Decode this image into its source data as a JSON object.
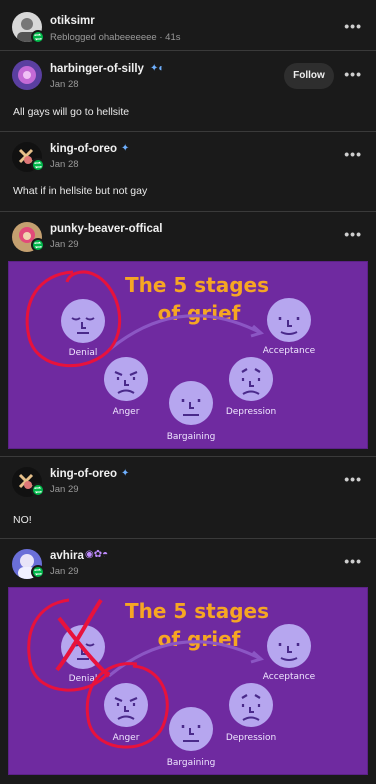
{
  "posts": [
    {
      "username": "otiksimr",
      "meta": "Reblogged ohabeeeeeee · 41s",
      "dots": "•••"
    },
    {
      "username": "harbinger-of-silly",
      "meta": "Jan 28",
      "follow": "Follow",
      "dots": "•••",
      "text": "All gays will go to hellsite"
    },
    {
      "username": "king-of-oreo",
      "meta": "Jan 28",
      "dots": "•••",
      "text": "What if in hellsite but not gay"
    },
    {
      "username": "punky-beaver-offical",
      "meta": "Jan 29",
      "dots": "•••"
    },
    {
      "username": "king-of-oreo",
      "meta": "Jan 29",
      "dots": "•••",
      "text": "NO!"
    },
    {
      "username": "avhira",
      "meta": "Jan 29",
      "dots": "•••"
    }
  ],
  "grief": {
    "title_line1": "The 5 stages",
    "title_line2": "of grief",
    "denial": "Denial",
    "anger": "Anger",
    "bargaining": "Bargaining",
    "depression": "Depression",
    "acceptance": "Acceptance",
    "bg_color": "#6f2aa0",
    "title_color": "#f6a623",
    "face_color": "#b6a6ef",
    "scribble_color": "#e8123c"
  }
}
